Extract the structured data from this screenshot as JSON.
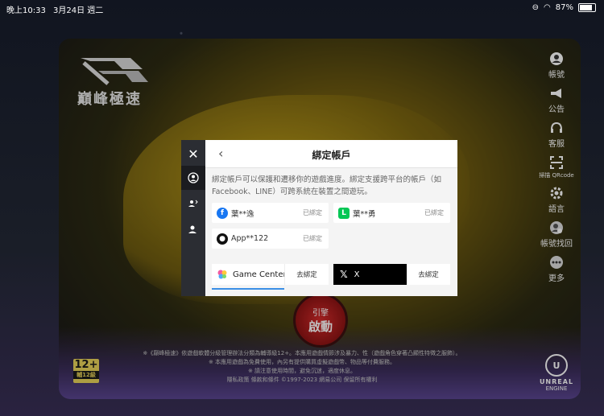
{
  "status_bar": {
    "time": "晚上10:33",
    "date": "3月24日 週二",
    "battery": "87%"
  },
  "game": {
    "logo_text": "巔峰極速",
    "right_menu": [
      {
        "label": "帳號",
        "icon": "account-icon"
      },
      {
        "label": "公告",
        "icon": "megaphone-icon"
      },
      {
        "label": "客服",
        "icon": "headset-icon"
      },
      {
        "label": "掃描 QRcode",
        "icon": "qr-scan-icon"
      },
      {
        "label": "語言",
        "icon": "gear-icon"
      },
      {
        "label": "帳號找回",
        "icon": "account-recovery-icon"
      },
      {
        "label": "更多",
        "icon": "more-icon"
      }
    ],
    "launch": {
      "line1": "引擎",
      "line2": "啟動"
    },
    "rating": {
      "age": "12+",
      "label": "輔12級"
    },
    "legal_lines": [
      "※《巔峰極速》依遊戲軟體分級管理辦法分類為輔導級12+。本應用遊戲情節涉及暴力、性（遊戲角色穿著凸顯性特徵之服飾）。",
      "※ 本應用遊戲為免費使用，內另有提供購買虛擬遊戲幣、物品等付費服務。",
      "※ 請注意使用時間，避免沉迷，適度休息。",
      "隱私政策 條款和條件 ©1997-2023 網易公司 保留所有權利"
    ],
    "engine": {
      "brand": "UNREAL",
      "sub": "ENGINE"
    }
  },
  "dialog": {
    "title": "綁定帳戶",
    "description": "綁定帳戶可以保護和遷移你的遊戲進度。綁定支援跨平台的帳戶（如 Facebook、LINE）可跨系統在裝置之間遊玩。",
    "bound_accounts": [
      {
        "provider": "facebook",
        "name": "葉**逸",
        "status": "已綁定",
        "color": "#1877f2"
      },
      {
        "provider": "line",
        "name": "葉**勇",
        "status": "已綁定",
        "color": "#06c755"
      },
      {
        "provider": "apple",
        "name": "App**122",
        "status": "已綁定",
        "color": "#111111"
      }
    ],
    "unbound": [
      {
        "provider": "Game Center",
        "action": "去綁定"
      },
      {
        "provider": "X",
        "action": "去綁定"
      }
    ]
  }
}
